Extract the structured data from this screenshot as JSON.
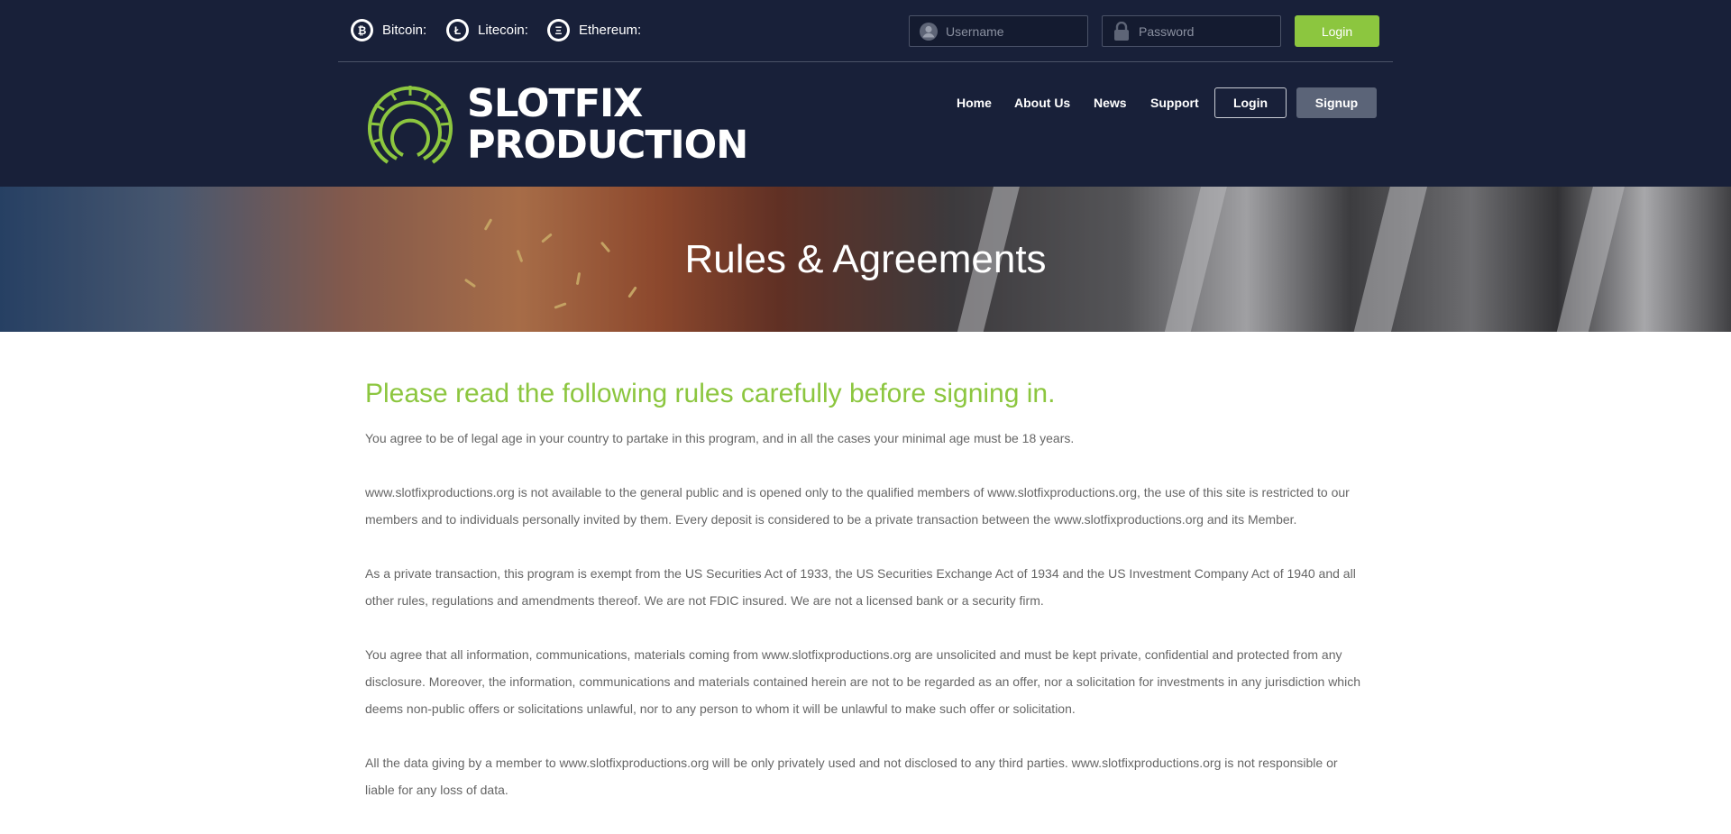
{
  "colors": {
    "header_bg": "#182039",
    "accent_green": "#8cc63f",
    "signup_bg": "#5b6478",
    "text_gray": "#666666"
  },
  "topbar": {
    "coins": [
      {
        "label": "Bitcoin:",
        "icon": "bitcoin-icon",
        "glyph": "₿"
      },
      {
        "label": "Litecoin:",
        "icon": "litecoin-icon",
        "glyph": "Ł"
      },
      {
        "label": "Ethereum:",
        "icon": "ethereum-icon",
        "glyph": "Ξ"
      }
    ],
    "username_placeholder": "Username",
    "password_placeholder": "Password",
    "login_label": "Login"
  },
  "logo": {
    "line1": "SLOTFIX",
    "line2": "PRODUCTION"
  },
  "nav": {
    "items": [
      "Home",
      "About Us",
      "News",
      "Support"
    ],
    "login_label": "Login",
    "signup_label": "Signup"
  },
  "banner": {
    "title": "Rules & Agreements"
  },
  "main": {
    "heading": "Please read the following rules carefully before signing in.",
    "paragraphs": [
      "You agree to be of legal age in your country to partake in this program, and in all the cases your minimal age must be 18 years.",
      "www.slotfixproductions.org is not available to the general public and is opened only to the qualified members of www.slotfixproductions.org, the use of this site is restricted to our members and to individuals personally invited by them. Every deposit is considered to be a private transaction between the www.slotfixproductions.org and its Member.",
      "As a private transaction, this program is exempt from the US Securities Act of 1933, the US Securities Exchange Act of 1934 and the US Investment Company Act of 1940 and all other rules, regulations and amendments thereof. We are not FDIC insured. We are not a licensed bank or a security firm.",
      "You agree that all information, communications, materials coming from www.slotfixproductions.org are unsolicited and must be kept private, confidential and protected from any disclosure. Moreover, the information, communications and materials contained herein are not to be regarded as an offer, nor a solicitation for investments in any jurisdiction which deems non-public offers or solicitations unlawful, nor to any person to whom it will be unlawful to make such offer or solicitation.",
      "All the data giving by a member to www.slotfixproductions.org will be only privately used and not disclosed to any third parties. www.slotfixproductions.org is not responsible or liable for any loss of data."
    ]
  }
}
